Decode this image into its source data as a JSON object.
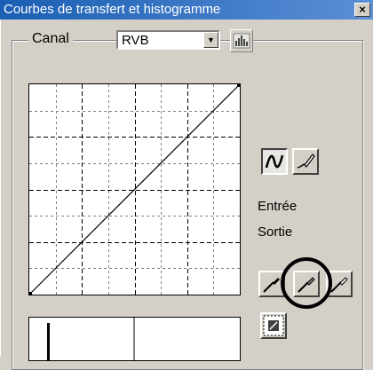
{
  "window": {
    "title": "Courbes de transfert et histogramme",
    "close_glyph": "×"
  },
  "canal": {
    "label": "Canal",
    "value": "RVB"
  },
  "labels": {
    "input": "Entrée",
    "output": "Sortie"
  },
  "icons": {
    "curve": "curve-icon",
    "freehand": "pencil-icon",
    "black_point": "eyedropper-black-icon",
    "gray_point": "eyedropper-gray-icon",
    "white_point": "eyedropper-white-icon",
    "reset": "reset-curve-icon",
    "histogram": "histogram-icon"
  },
  "chart_data": {
    "type": "line",
    "title": "",
    "xlabel": "",
    "ylabel": "",
    "xlim": [
      0,
      255
    ],
    "ylim": [
      0,
      255
    ],
    "grid": true,
    "series": [
      {
        "x": [
          0,
          255
        ],
        "values": [
          0,
          255
        ]
      }
    ]
  }
}
